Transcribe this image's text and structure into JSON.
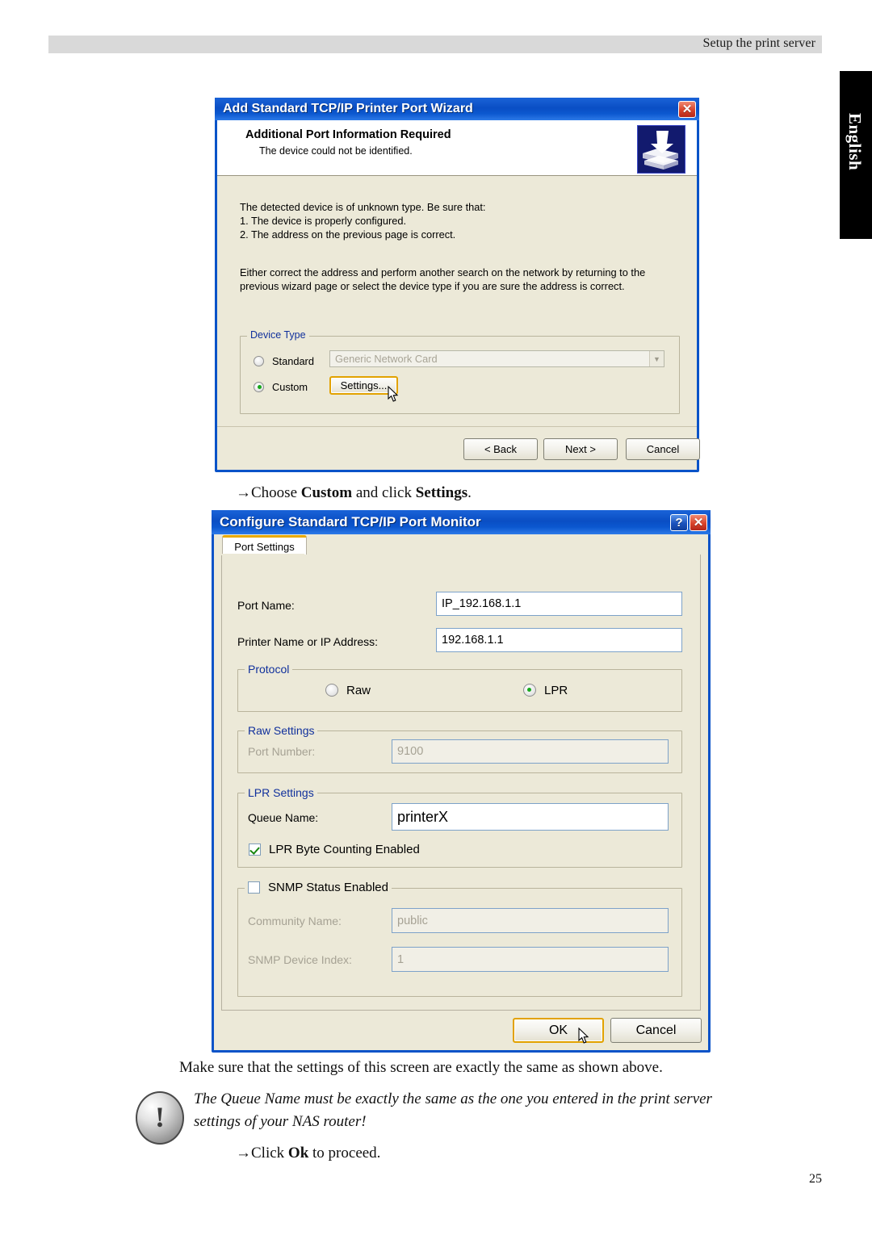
{
  "page": {
    "header_title": "Setup the print server",
    "language_tab": "English",
    "page_number": "25"
  },
  "dialog1": {
    "title": "Add Standard TCP/IP Printer Port Wizard",
    "close_label": "✕",
    "header_heading": "Additional Port Information Required",
    "header_subtext": "The device could not be identified.",
    "printer_icon_name": "printer-icon",
    "body_paragraph_1": "The detected device is of unknown type.  Be sure that:\n1. The device is properly configured.\n2.  The address on the previous page is correct.",
    "body_paragraph_2": "Either correct the address and perform another search on the network by returning to the previous wizard page or select the device type if you are sure the address is correct.",
    "device_type": {
      "legend": "Device Type",
      "standard_label": "Standard",
      "standard_selected": false,
      "standard_combo_value": "Generic Network Card",
      "custom_label": "Custom",
      "custom_selected": true,
      "settings_button": "Settings..."
    },
    "buttons": {
      "back": "< Back",
      "next": "Next >",
      "cancel": "Cancel"
    }
  },
  "caption1": {
    "arrow": "→",
    "text_before": "Choose ",
    "bold1": "Custom",
    "text_middle": " and click ",
    "bold2": "Settings",
    "text_after": "."
  },
  "dialog2": {
    "title": "Configure Standard TCP/IP Port Monitor",
    "help_label": "?",
    "close_label": "✕",
    "tab_label": "Port Settings",
    "port_name_label": "Port Name:",
    "port_name_value": "IP_192.168.1.1",
    "printer_name_label": "Printer Name or IP Address:",
    "printer_name_value": "192.168.1.1",
    "protocol": {
      "legend": "Protocol",
      "raw_label": "Raw",
      "raw_selected": false,
      "lpr_label": "LPR",
      "lpr_selected": true
    },
    "raw_settings": {
      "legend": "Raw Settings",
      "port_number_label": "Port Number:",
      "port_number_value": "9100",
      "enabled": false
    },
    "lpr_settings": {
      "legend": "LPR Settings",
      "queue_name_label": "Queue Name:",
      "queue_name_value": "printerX",
      "byte_counting_label": "LPR Byte Counting Enabled",
      "byte_counting_checked": true
    },
    "snmp_settings": {
      "status_label": "SNMP Status Enabled",
      "status_checked": false,
      "community_label": "Community Name:",
      "community_value": "public",
      "device_index_label": "SNMP Device Index:",
      "device_index_value": "1"
    },
    "buttons": {
      "ok": "OK",
      "cancel": "Cancel"
    }
  },
  "notes": {
    "line1": "Make sure that the settings of this screen are exactly the same as shown above.",
    "warning_line1": "The Queue Name must be exactly the same as the one you entered in the print server",
    "warning_line2": "settings of your NAS router!",
    "warning_icon_glyph": "!",
    "caption2_arrow": "→",
    "caption2_before": "Click ",
    "caption2_bold": "Ok",
    "caption2_after": " to proceed."
  },
  "colors": {
    "title_bar_blue": "#0a4ec4",
    "dialog_face": "#ece9d8",
    "group_legend_blue": "#10309c",
    "focus_gold": "#e2a200",
    "radio_green": "#18a81c",
    "check_green": "#17860f",
    "header_band_gray": "#d9d9d9"
  }
}
